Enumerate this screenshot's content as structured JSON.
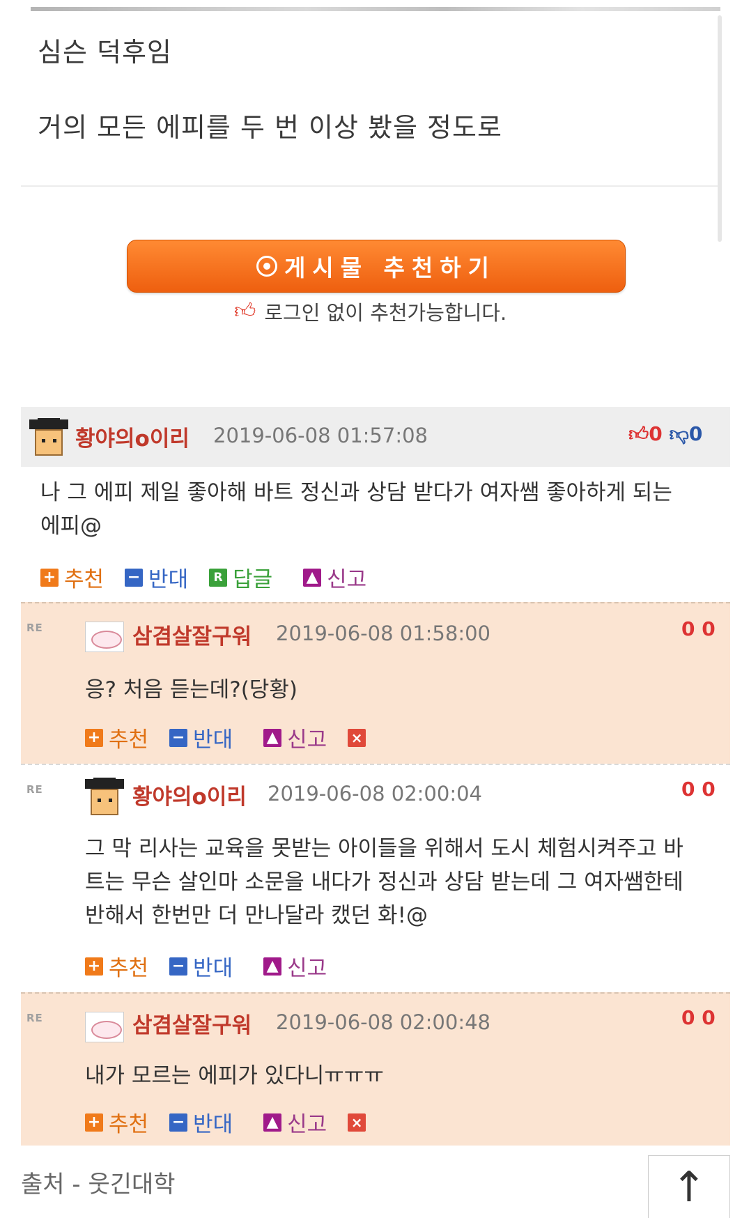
{
  "post": {
    "line1": "심슨 덕후임",
    "line2": "거의 모든 에피를 두 번 이상 봤을 정도로"
  },
  "recommend": {
    "button_label": "게시물 추천하기",
    "note": "로그인 없이 추천가능합니다."
  },
  "comments": [
    {
      "nick": "황야의o이리",
      "date": "2019-06-08 01:57:08",
      "up": "0",
      "down": "0",
      "text_line1": "나 그 에피 제일 좋아해 바트 정신과 상담 받다가 여자쌤 좋아하게 되는",
      "text_line2": "에피@",
      "actions": {
        "up": "추천",
        "down": "반대",
        "reply": "답글",
        "report": "신고"
      }
    },
    {
      "re": "RE",
      "nick": "삼겸살잘구워",
      "date": "2019-06-08 01:58:00",
      "votes": "0 0",
      "text": "응? 처음 듣는데?(당황)",
      "actions": {
        "up": "추천",
        "down": "반대",
        "report": "신고"
      }
    },
    {
      "re": "RE",
      "nick": "황야의o이리",
      "date": "2019-06-08 02:00:04",
      "votes": "0 0",
      "text_line1": "그 막 리사는 교육을 못받는 아이들을 위해서 도시 체험시켜주고 바",
      "text_line2": "트는 무슨 살인마 소문을 내다가 정신과 상담 받는데 그 여자쌤한테",
      "text_line3": "반해서 한번만 더 만나달라 캤던 화!@",
      "actions": {
        "up": "추천",
        "down": "반대",
        "report": "신고"
      }
    },
    {
      "re": "RE",
      "nick": "삼겸살잘구워",
      "date": "2019-06-08 02:00:48",
      "votes": "0 0",
      "text": "내가 모르는 에피가 있다니ㅠㅠㅠ",
      "actions": {
        "up": "추천",
        "down": "반대",
        "report": "신고"
      }
    }
  ],
  "footer": {
    "source": "출처 - 웃긴대학"
  },
  "icons": {
    "avatar1": "pixel-character-avatar",
    "avatar2": "pig-avatar",
    "to_top": "arrow-up-icon"
  },
  "colors": {
    "accent": "#ee6a1a",
    "nick": "#c0392b",
    "reply_bg": "#fbe4d2"
  }
}
